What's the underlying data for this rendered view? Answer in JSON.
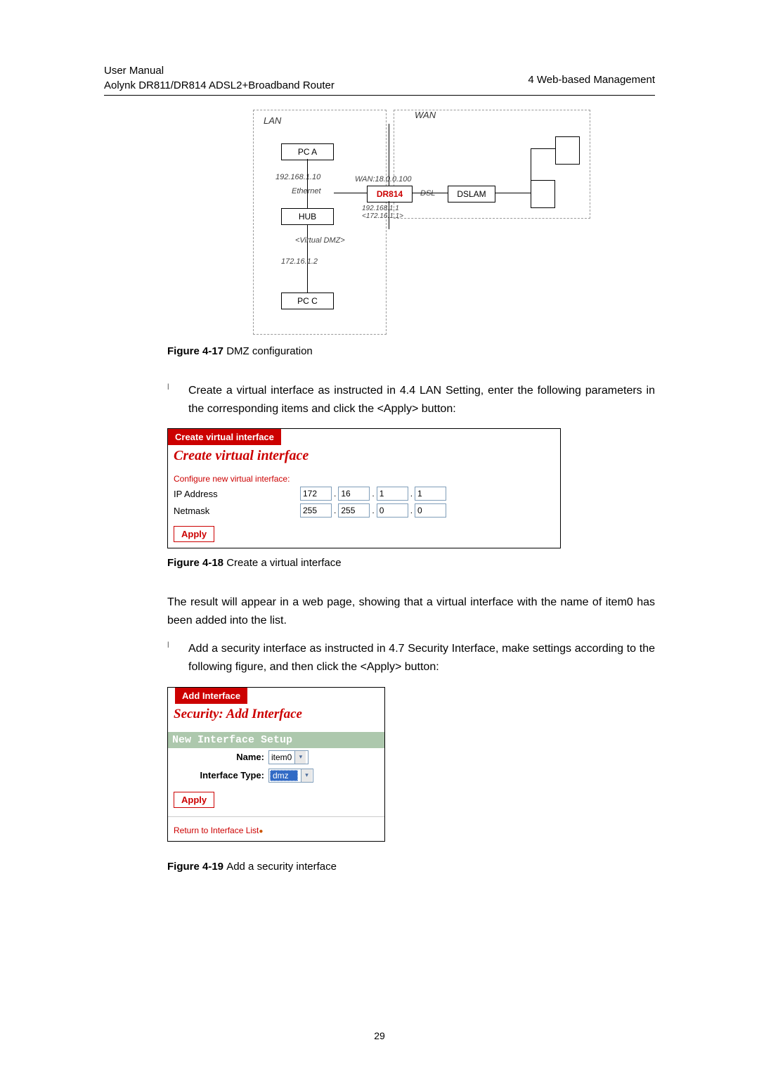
{
  "header": {
    "line1": "User Manual",
    "line2": "Aolynk DR811/DR814 ADSL2+Broadband Router",
    "right": "4  Web-based Management"
  },
  "diagram": {
    "lan": "LAN",
    "wan": "WAN",
    "pca": "PC A",
    "pca_ip": "192.168.1.10",
    "ethernet": "Ethernet",
    "hub": "HUB",
    "virtual_dmz": "<Virtual DMZ>",
    "pcc_ip": "172.16.1.2",
    "pcc": "PC C",
    "wan_ip": "WAN:18.0.0.100",
    "dr814": "DR814",
    "router_ips": "192.168.1.1\n<172.16.1.1>",
    "dsl": "DSL",
    "dslam": "DSLAM"
  },
  "captions": {
    "fig17_bold": "Figure 4-17 ",
    "fig17_text": "DMZ configuration",
    "fig18_bold": "Figure 4-18 ",
    "fig18_text": "Create a virtual interface",
    "fig19_bold": "Figure 4-19 ",
    "fig19_text": "Add a security interface"
  },
  "bullets": {
    "bullet1": "Create a virtual interface as instructed in 4.4  LAN Setting, enter the following parameters in the corresponding items and click the <Apply> button:",
    "bullet2": "Add a security interface as instructed in 4.7  Security Interface, make settings according to the following figure, and then click the <Apply> button:"
  },
  "body": {
    "result_text": "The result will appear in a web page, showing that a virtual interface with the name of item0 has been added into the list."
  },
  "screenshot1": {
    "header": "Create virtual interface",
    "title": "Create virtual interface",
    "config_text": "Configure new virtual interface:",
    "ip_label": "IP Address",
    "netmask_label": "Netmask",
    "ip": [
      "172",
      "16",
      "1",
      "1"
    ],
    "netmask": [
      "255",
      "255",
      "0",
      "0"
    ],
    "apply": "Apply"
  },
  "screenshot2": {
    "header": "Add Interface",
    "title": "Security: Add Interface",
    "banner": "New Interface Setup",
    "name_label": "Name:",
    "name_value": "item0",
    "type_label": "Interface Type:",
    "type_value": "dmz",
    "apply": "Apply",
    "return_link": "Return to Interface List"
  },
  "page_number": "29"
}
